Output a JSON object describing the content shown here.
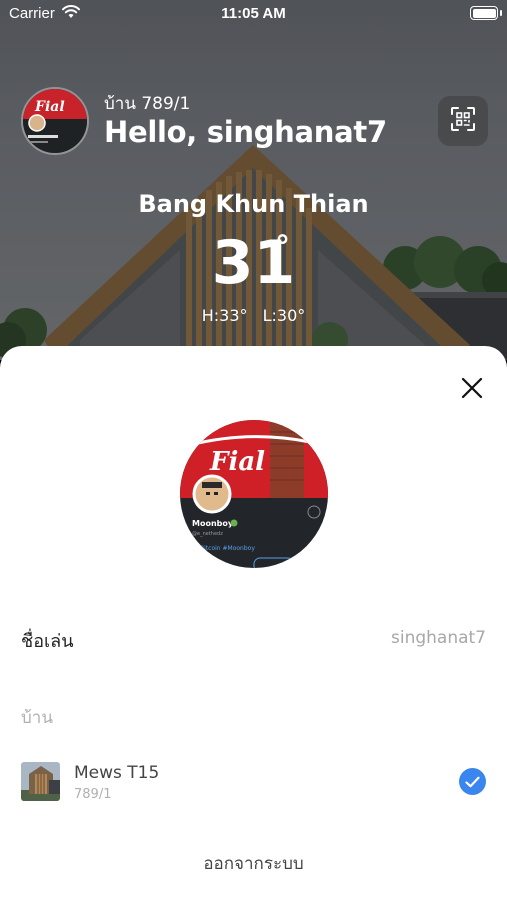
{
  "status_bar": {
    "carrier": "Carrier",
    "time": "11:05 AM"
  },
  "header": {
    "home_label": "บ้าน 789/1",
    "greeting": "Hello, singhanat7",
    "qr_icon": "qr-scan-icon"
  },
  "weather": {
    "city": "Bang Khun Thian",
    "temperature": "31",
    "unit": "°",
    "high": "H:33°",
    "low": "L:30°"
  },
  "profile_sheet": {
    "nickname_label": "ชื่อเล่น",
    "nickname_value": "singhanat7",
    "homes_label": "บ้าน",
    "homes": [
      {
        "name": "Mews T15",
        "address": "789/1",
        "selected": true
      }
    ],
    "logout_label": "ออกจากระบบ",
    "accent_color": "#3a86ee"
  }
}
